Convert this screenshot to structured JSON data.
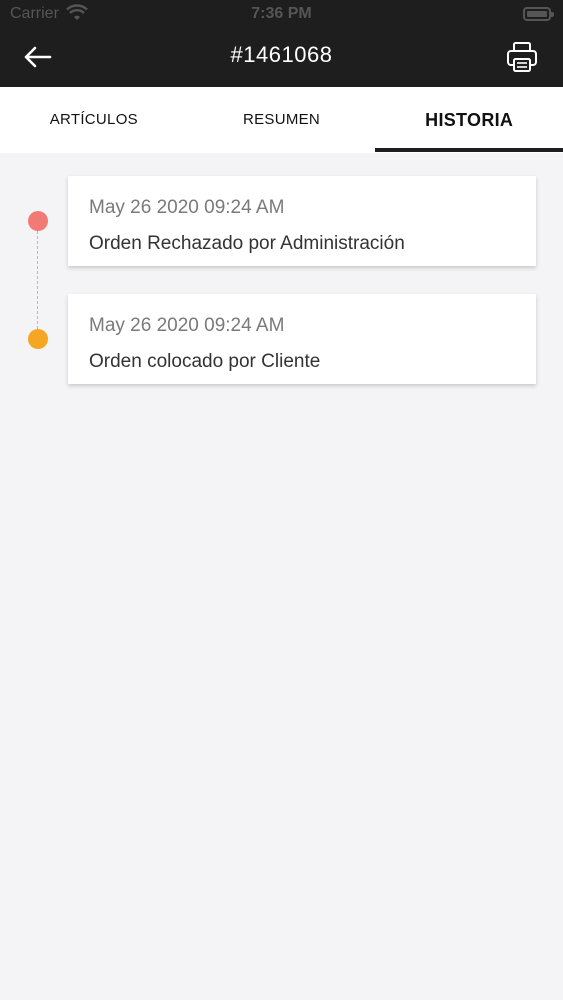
{
  "status_bar": {
    "carrier": "Carrier",
    "time": "7:36 PM"
  },
  "header": {
    "title": "#1461068",
    "back_icon": "arrow-left-icon",
    "print_icon": "printer-icon"
  },
  "tabs": [
    {
      "label": "ARTÍCULOS",
      "active": false
    },
    {
      "label": "RESUMEN",
      "active": false
    },
    {
      "label": "HISTORIA",
      "active": true
    }
  ],
  "history": [
    {
      "date": "May 26 2020 09:24 AM",
      "message": "Orden Rechazado por Administración",
      "dot_color": "#f27a75"
    },
    {
      "date": "May 26 2020 09:24 AM",
      "message": "Orden colocado por Cliente",
      "dot_color": "#f5a623"
    }
  ],
  "colors": {
    "header_bg": "#1e1e1e",
    "page_bg": "#f4f4f6"
  }
}
